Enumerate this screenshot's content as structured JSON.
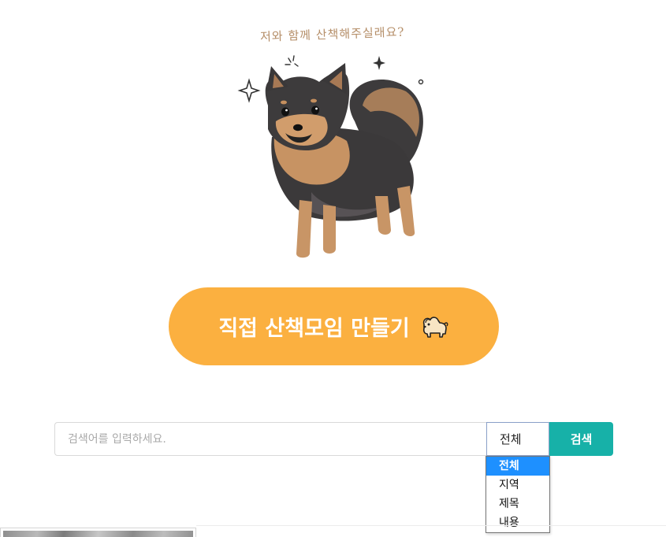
{
  "hero": {
    "caption": "저와 함께 산책해주실래요?",
    "illustration_icon": "pomeranian-dog-illustration"
  },
  "cta": {
    "label": "직접 산책모임 만들기",
    "icon": "dog-icon"
  },
  "search": {
    "placeholder": "검색어를 입력하세요.",
    "value": "",
    "filter_selected": "전체",
    "filter_options": [
      "전체",
      "지역",
      "제목",
      "내용"
    ],
    "button_label": "검색"
  },
  "colors": {
    "cta_background": "#fbb040",
    "search_button": "#17b1a8",
    "dropdown_highlight": "#1e90ff",
    "caption_text": "#b58e68"
  }
}
